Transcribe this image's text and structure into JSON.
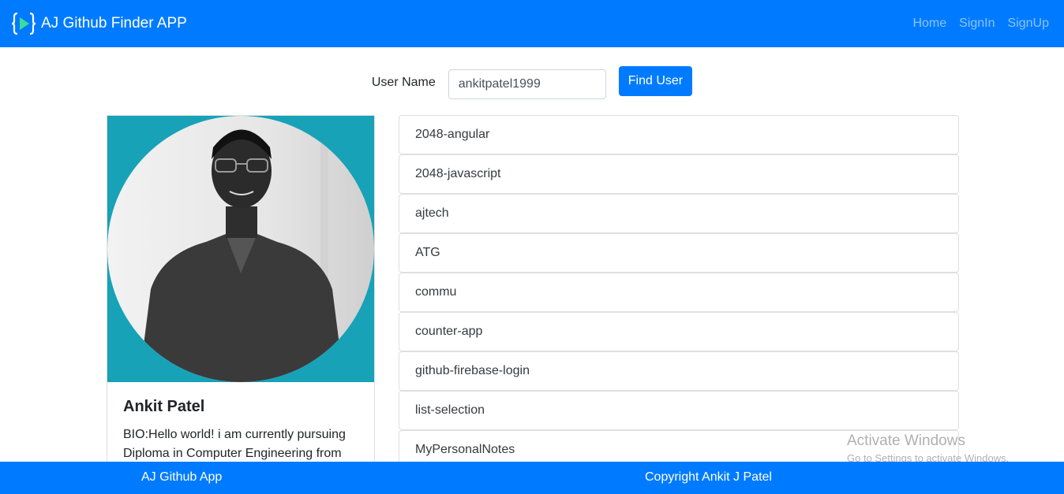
{
  "navbar": {
    "brand": "AJ Github Finder APP",
    "logo_icon": "code-brackets-play-icon",
    "links": [
      "Home",
      "SignIn",
      "SignUp"
    ],
    "bg_color": "#007bff"
  },
  "search": {
    "label": "User Name",
    "value": "ankitpatel1999",
    "button": "Find User"
  },
  "profile": {
    "name": "Ankit Patel",
    "bio": "BIO:Hello world! i am currently pursuing Diploma in Computer Engineering from",
    "image_bg": "#17a2b8"
  },
  "repos": [
    "2048-angular",
    "2048-javascript",
    "ajtech",
    "ATG",
    "commu",
    "counter-app",
    "github-firebase-login",
    "list-selection",
    "MyPersonalNotes"
  ],
  "watermark": {
    "title": "Activate Windows",
    "subtitle": "Go to Settings to activate Windows."
  },
  "footer": {
    "left": "AJ Github App",
    "right": "Copyright Ankit J Patel"
  }
}
